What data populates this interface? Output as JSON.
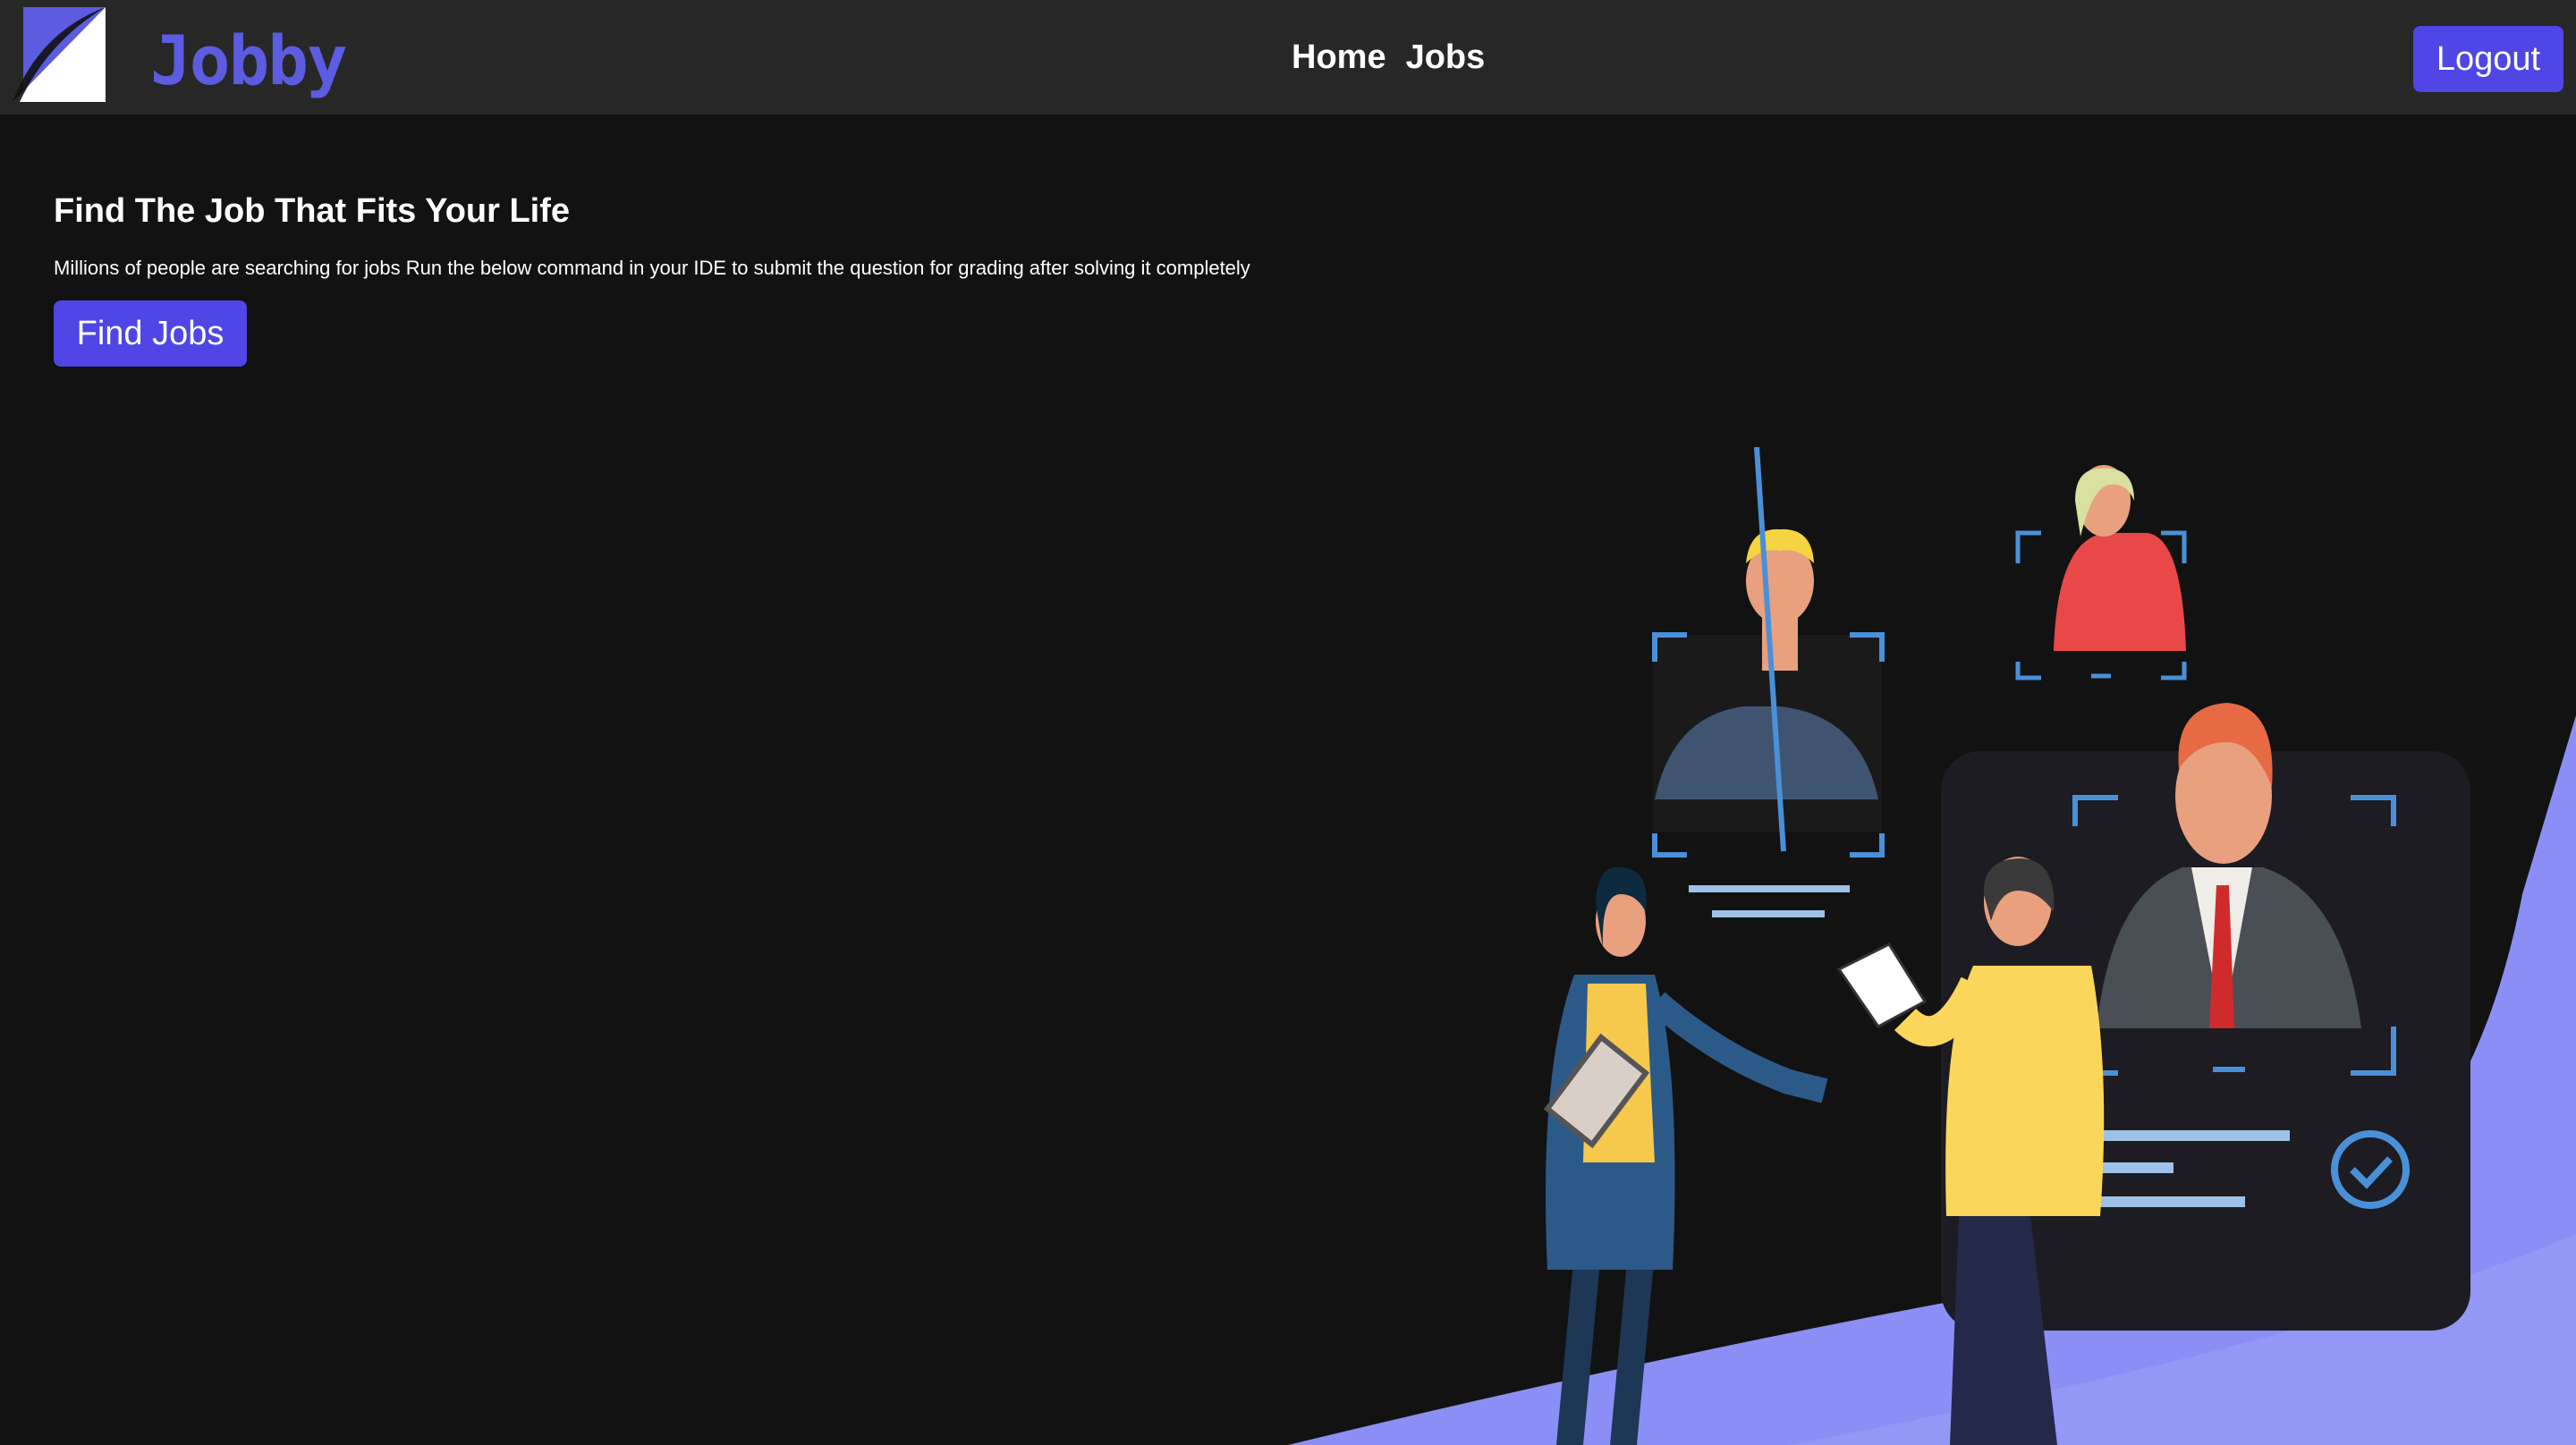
{
  "navbar": {
    "brand": "Jobby",
    "links": [
      {
        "label": "Home"
      },
      {
        "label": "Jobs"
      }
    ],
    "logout_label": "Logout"
  },
  "hero": {
    "title": "Find The Job That Fits Your Life",
    "description": "Millions of people are searching for jobs Run the below command in your IDE to submit the question for grading after solving it completely",
    "button_label": "Find Jobs"
  },
  "colors": {
    "background": "#121212",
    "navbar": "#272727",
    "accent": "#4f46e5",
    "brand": "#5b5ce0",
    "wave": "#8b8ff5"
  },
  "icons": {
    "logo": "jobby-logo-icon",
    "illustration": "recruitment-illustration"
  }
}
